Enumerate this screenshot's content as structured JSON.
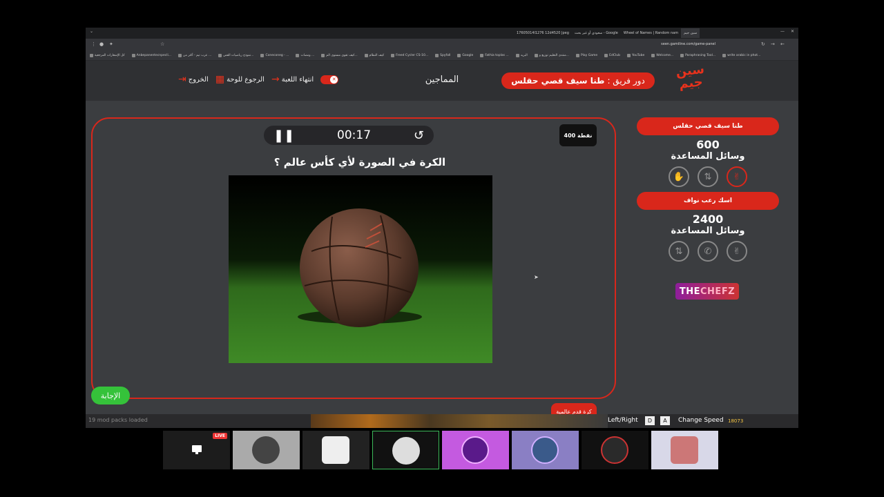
{
  "browser": {
    "tabs": [
      "17605014l1276 12d4520 Jpeg",
      "سعودي أو غير بحث - Google",
      "Wheel of Names | Random nam",
      "سين جيم"
    ],
    "url": "seen.gamiline.com/game-panel",
    "bookmarks": [
      "كل الإشعارات المرجعية",
      "Anbepanentecnpecli...",
      "عرب تيم - أكثر من ...",
      "نموذج رياضيات القص...",
      "Coneconeg - ...",
      "ومضات ...",
      "كيف تقوي مستوى الم...",
      "كيف النظام",
      "Freed Cycler CS-10...",
      "Spyfall",
      "Google",
      "Fathia toplas ...",
      "البريد",
      "منتدى التعليم توزيع و...",
      "Play Game",
      "EdClub",
      "YouTube",
      "Welcome...",
      "Paraphrasing Tool...",
      "write arabic in phot..."
    ]
  },
  "header": {
    "logo_text": "سين جيم",
    "turn_label": "دور فريق :",
    "turn_team": "طنا سيف قصي حقلس",
    "game_name": "المماجين",
    "end_game": "انتهاء اللعبة",
    "back_to_board": "الرجوع للوحة",
    "exit": "الخروج"
  },
  "question": {
    "timer": "00:17",
    "points": "400 نقطة",
    "text": "الكرة في الصورة لأي كأس عالم ؟",
    "answer_button": "الإجابة",
    "category": "كرة قدم عالمية"
  },
  "teams": [
    {
      "name": "طنا سيف قصي حقلس",
      "score": "600",
      "aids_label": "وسائل المساعدة",
      "aids": [
        "hand-stop-icon",
        "swap-icon",
        "two-fingers-icon"
      ]
    },
    {
      "name": "اسك رعب نواف",
      "score": "2400",
      "aids_label": "وسائل المساعدة",
      "aids": [
        "swap-icon",
        "phone-icon",
        "two-fingers-icon"
      ]
    }
  ],
  "sponsor": {
    "prefix": "THE",
    "name": "CHEFZ"
  },
  "stream": {
    "status_text": "19 mod packs loaded",
    "controls_text": "Left/Right",
    "key_d": "D",
    "key_a": "A",
    "change_speed": "Change Speed",
    "counter": "18073"
  },
  "participants": {
    "live_badge": "LIVE",
    "tiles": 8
  },
  "colors": {
    "accent_red": "#d9271b",
    "answer_green": "#35c23a",
    "panel_bg": "#3b3d40",
    "header_bg": "#2f3033"
  }
}
